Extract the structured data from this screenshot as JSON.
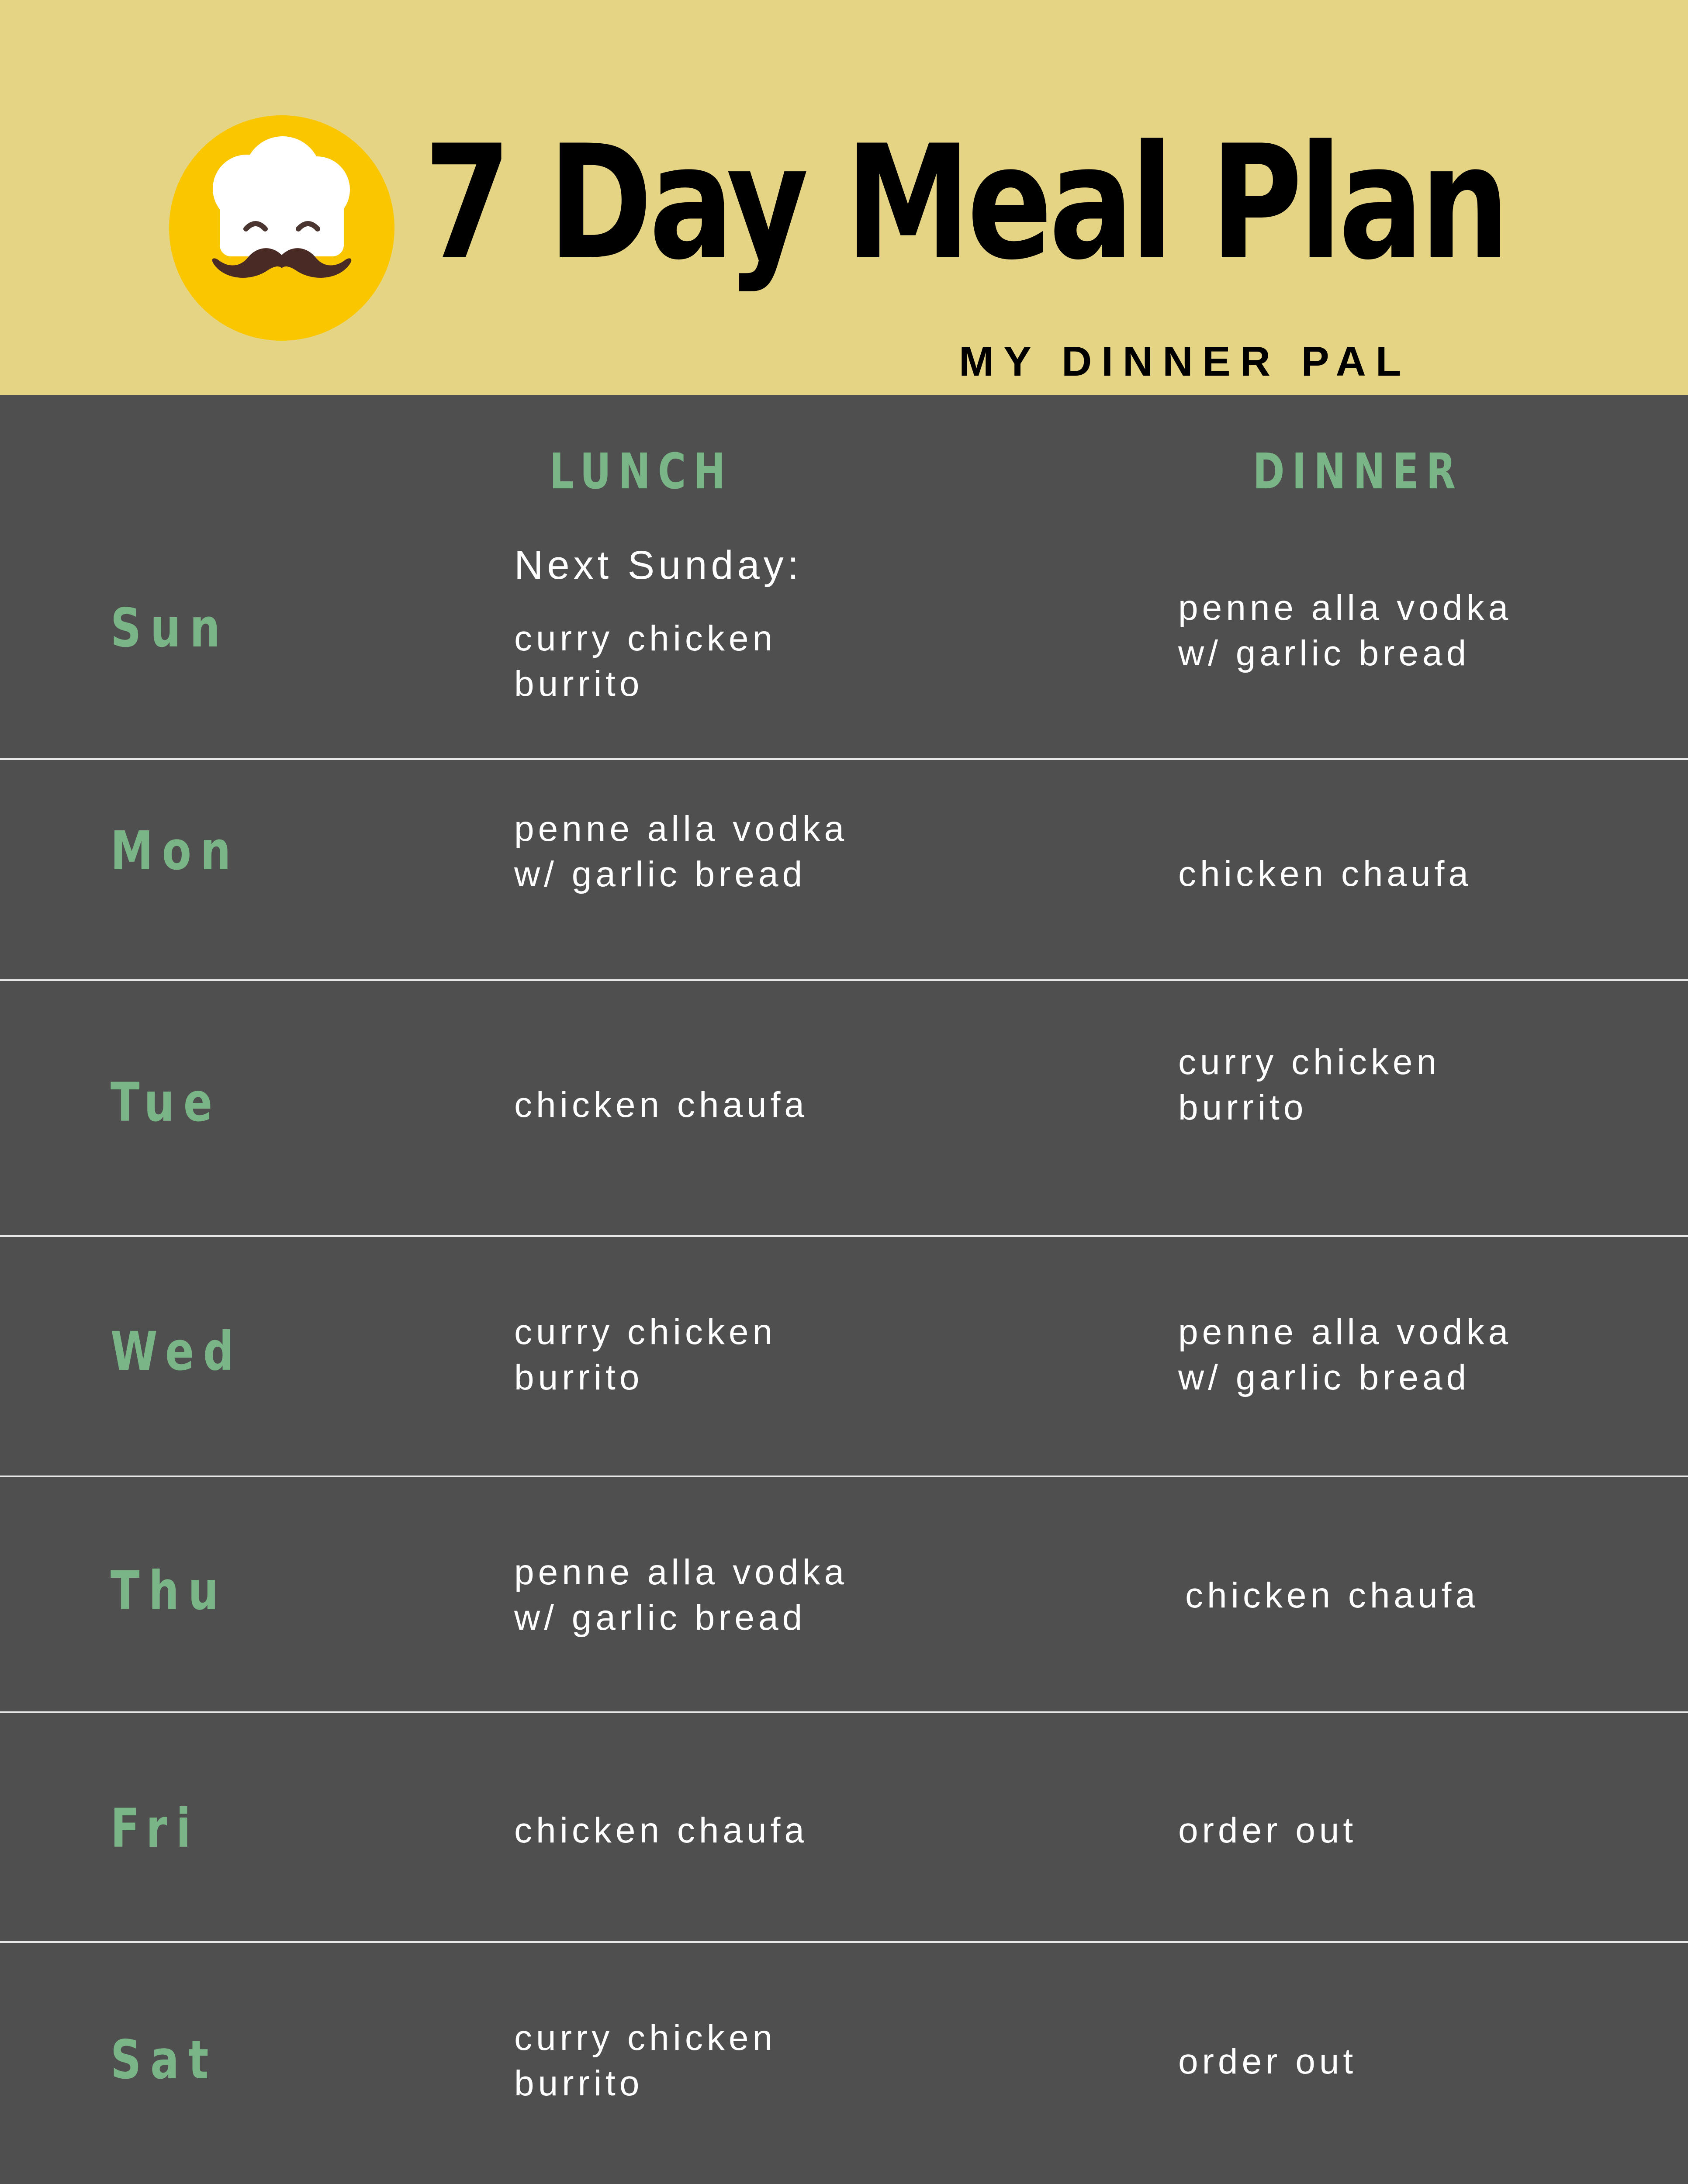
{
  "header": {
    "title": "7 Day Meal Plan",
    "subtitle": "MY DINNER PAL",
    "logo_icon": "chef-hat-mustache-icon",
    "background_color": "#e5d483",
    "logo_color": "#f9c600"
  },
  "columns": {
    "lunch": "LUNCH",
    "dinner": "DINNER"
  },
  "accent_color": "#79b586",
  "table_background": "#4f4f4f",
  "days": [
    {
      "day": "Sun",
      "note": "Next Sunday:",
      "lunch": "curry chicken\nburrito",
      "dinner": "penne alla vodka\nw/ garlic bread"
    },
    {
      "day": "Mon",
      "lunch": "penne alla vodka\nw/ garlic bread",
      "dinner": "chicken chaufa"
    },
    {
      "day": "Tue",
      "lunch": "chicken chaufa",
      "dinner": "curry chicken\nburrito"
    },
    {
      "day": "Wed",
      "lunch": "curry chicken\nburrito",
      "dinner": "penne alla vodka\nw/ garlic bread"
    },
    {
      "day": "Thu",
      "lunch": "penne alla vodka\nw/ garlic bread",
      "dinner": "chicken chaufa"
    },
    {
      "day": "Fri",
      "lunch": "chicken chaufa",
      "dinner": "order out"
    },
    {
      "day": "Sat",
      "lunch": "curry chicken\nburrito",
      "dinner": "order out"
    }
  ]
}
